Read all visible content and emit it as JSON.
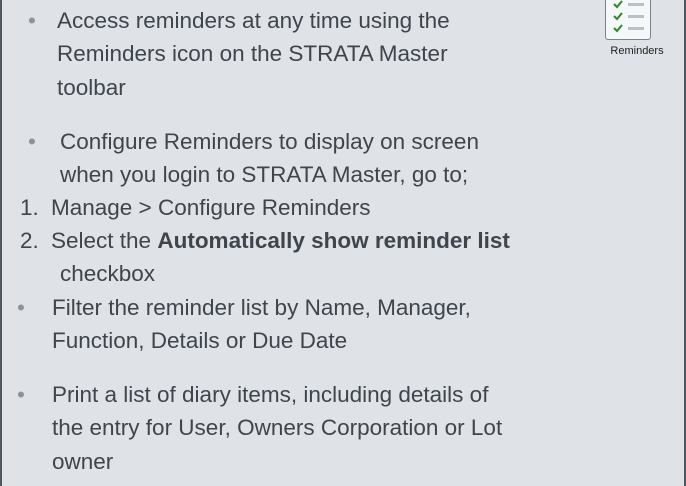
{
  "bullets": [
    {
      "lines": [
        "Access reminders at any time using the",
        "Reminders icon on the STRATA Master",
        "toolbar"
      ]
    },
    {
      "lines": [
        "Configure Reminders to display on screen",
        "when you login to STRATA Master, go to;"
      ],
      "steps": [
        {
          "number": "1.",
          "text": "Manage > Configure Reminders"
        },
        {
          "number": "2.",
          "text_before": "Select the ",
          "text_bold": "Automatically show reminder list",
          "text_after": "checkbox"
        }
      ]
    },
    {
      "lines": [
        "Filter the reminder list by Name, Manager,",
        "Function, Details or Due Date"
      ]
    },
    {
      "lines": [
        "Print a list of diary items, including details of",
        "the entry for User, Owners Corporation or Lot",
        "owner"
      ]
    }
  ],
  "bullet_symbol": "•",
  "reminders_icon": {
    "caption": "Reminders",
    "icon": "checklist-icon"
  },
  "colors": {
    "background": "#dfe2e6",
    "text": "#3f454d",
    "bullet": "#8b939c",
    "border": "#4e5660",
    "check": "#2a8a2a"
  }
}
